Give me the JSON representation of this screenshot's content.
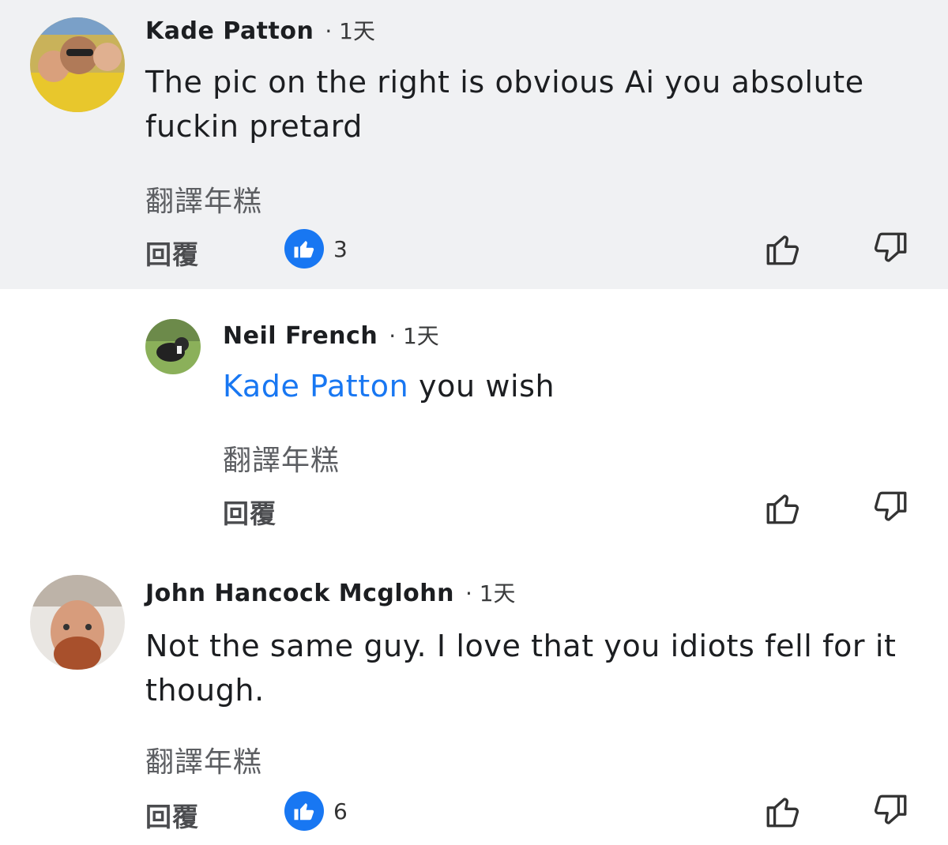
{
  "comments": [
    {
      "author": "Kade Patton",
      "time": "· 1天",
      "text": "The pic on the right is obvious Ai you absolute fuckin pretard",
      "translate": "翻譯年糕",
      "reply": "回覆",
      "reaction_count": "3"
    },
    {
      "author": "Neil French",
      "time": "· 1天",
      "mention": "Kade Patton",
      "text": " you wish",
      "translate": "翻譯年糕",
      "reply": "回覆"
    },
    {
      "author": "John Hancock Mcglohn",
      "time": "· 1天",
      "text": "Not the same guy. I love that you idiots fell for it though.",
      "translate": "翻譯年糕",
      "reply": "回覆",
      "reaction_count": "6"
    }
  ],
  "icons": {
    "like_reaction": "thumbs-up-icon",
    "upvote": "thumbs-up-outline-icon",
    "downvote": "thumbs-down-outline-icon"
  },
  "colors": {
    "highlight_bg": "#f0f1f3",
    "accent": "#1877f2"
  }
}
